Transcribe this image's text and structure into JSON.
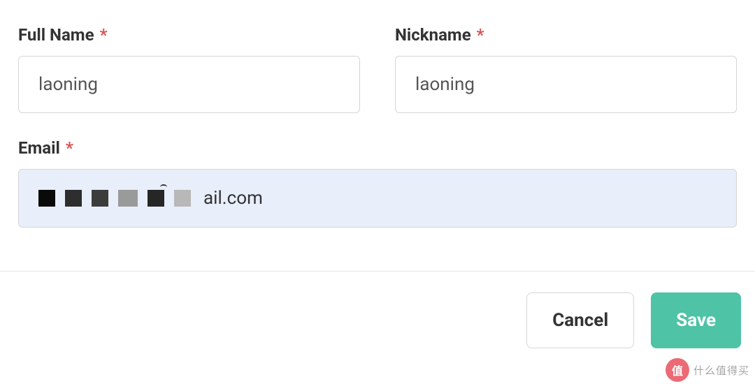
{
  "form": {
    "fullName": {
      "label": "Full Name",
      "required": "*",
      "value": "laoning"
    },
    "nickname": {
      "label": "Nickname",
      "required": "*",
      "value": "laoning"
    },
    "email": {
      "label": "Email",
      "required": "*",
      "visibleSuffix": "ail.com"
    }
  },
  "buttons": {
    "cancel": "Cancel",
    "save": "Save"
  },
  "watermark": {
    "badge": "值",
    "text": "什么值得买"
  }
}
